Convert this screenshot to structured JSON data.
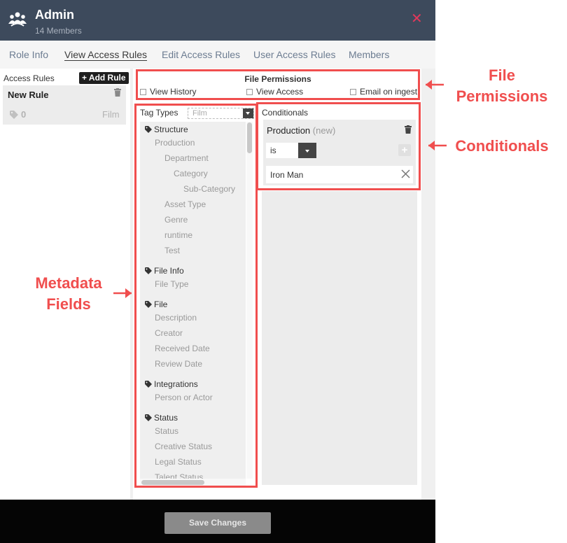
{
  "header": {
    "title": "Admin",
    "subtitle": "14 Members",
    "close_icon": "close-icon",
    "team_icon": "team-icon",
    "accent_color": "#e2385b",
    "background_color": "#3d4a5c"
  },
  "tabs": [
    {
      "label": "Role Info",
      "active": false
    },
    {
      "label": "View Access Rules",
      "active": true
    },
    {
      "label": "Edit Access Rules",
      "active": false
    },
    {
      "label": "User Access Rules",
      "active": false
    },
    {
      "label": "Members",
      "active": false
    }
  ],
  "sidebar": {
    "title": "Access Rules",
    "add_button": "+ Add Rule",
    "rules": [
      {
        "name": "New Rule",
        "count": "0",
        "type": "Film"
      }
    ]
  },
  "file_permissions": {
    "title": "File Permissions",
    "options": [
      {
        "label": "View History",
        "checked": false
      },
      {
        "label": "View Access",
        "checked": false
      },
      {
        "label": "Email on ingest",
        "checked": false
      }
    ]
  },
  "metadata": {
    "tag_types_label": "Tag Types",
    "tag_types_value": "Film",
    "groups": [
      {
        "name": "Structure",
        "fields": [
          "Production",
          "Department",
          "Category",
          "Sub-Category",
          "Asset Type",
          "Genre",
          "runtime",
          "Test"
        ]
      },
      {
        "name": "File Info",
        "fields": [
          "File Type"
        ]
      },
      {
        "name": "File",
        "fields": [
          "Description",
          "Creator",
          "Received Date",
          "Review Date"
        ]
      },
      {
        "name": "Integrations",
        "fields": [
          "Person or Actor"
        ]
      },
      {
        "name": "Status",
        "fields": [
          "Status",
          "Creative Status",
          "Legal Status",
          "Talent Status"
        ]
      }
    ]
  },
  "conditionals": {
    "title": "Conditionals",
    "field": "Production",
    "field_state": "(new)",
    "operator": "is",
    "value": "Iron Man"
  },
  "footer": {
    "save_label": "Save Changes"
  },
  "annotations": {
    "file_permissions": "File\nPermissions",
    "conditionals": "Conditionals",
    "metadata_fields": "Metadata\nFields",
    "color": "#f04e4e"
  }
}
